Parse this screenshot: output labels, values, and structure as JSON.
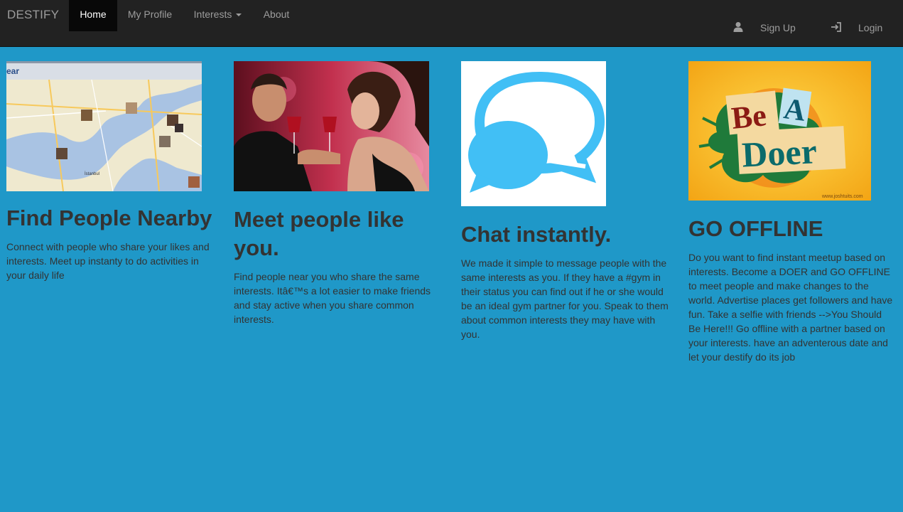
{
  "nav": {
    "brand": "DESTIFY",
    "items": [
      {
        "label": "Home",
        "active": true
      },
      {
        "label": "My Profile"
      },
      {
        "label": "Interests",
        "dropdown": true
      },
      {
        "label": "About"
      }
    ],
    "signup": {
      "label": "Sign Up",
      "icon": "user-icon"
    },
    "login": {
      "label": "Login",
      "icon": "login-icon"
    }
  },
  "features": [
    {
      "image": "map-image",
      "map_label_top": "ear",
      "map_label_city": "İstanbul",
      "title": "Find People Nearby",
      "text": "Connect with people who share your likes and interests. Meet up instanty to do activities in your daily life"
    },
    {
      "image": "couple-toast-image",
      "title": "Meet people like you.",
      "text": "Find people near you who share the same interests. Itâ€™s a lot easier to make friends and stay active when you share common interests."
    },
    {
      "image": "chat-bubbles-image",
      "title": "Chat instantly.",
      "text": "We made it simple to message people with the same interests as you. If they have a #gym in their status you can find out if he or she would be an ideal gym partner for you. Speak to them about common interests they may have with you."
    },
    {
      "image": "be-a-doer-image",
      "title": "GO OFFLINE",
      "text": "Do you want to find instant meetup based on interests. Become a DOER and GO OFFLINE to meet people and make changes to the world. Advertise places get followers and have fun. Take a selfie with friends -->You Should Be Here!!! Go offline with a partner based on your interests. have an adventerous date and let your destify do its job",
      "poster_line1": "Be",
      "poster_line1b": "A",
      "poster_line2": "Doer",
      "poster_credit": "www.joshtuits.com"
    }
  ],
  "colors": {
    "page_bg": "#1f98c8",
    "navbar_bg": "#222222",
    "active_bg": "#080808",
    "chat_blue": "#41bff5"
  }
}
